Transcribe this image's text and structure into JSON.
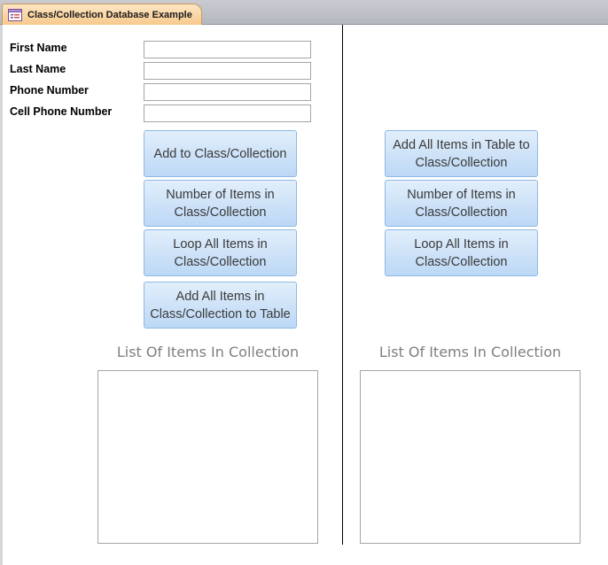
{
  "tab": {
    "title": "Class/Collection Database Example",
    "icon": "form-icon"
  },
  "fields": [
    {
      "label": "First Name",
      "value": ""
    },
    {
      "label": "Last Name",
      "value": ""
    },
    {
      "label": "Phone Number",
      "value": ""
    },
    {
      "label": "Cell Phone Number",
      "value": ""
    }
  ],
  "left_buttons": [
    "Add to Class/Collection",
    "Number of Items in Class/Collection",
    "Loop All Items in Class/Collection",
    "Add All Items in Class/Collection to Table"
  ],
  "right_buttons": [
    "Add All Items in Table to Class/Collection",
    "Number of Items in Class/Collection",
    "Loop All Items in Class/Collection"
  ],
  "left_list": {
    "title": "List Of Items In Collection",
    "items": []
  },
  "right_list": {
    "title": "List Of Items In Collection",
    "items": []
  },
  "colors": {
    "tab_active": "#f7c98c",
    "button_fill": "#cfe3f8",
    "button_border": "#8fb8e3",
    "list_title": "#7f7f7f"
  }
}
